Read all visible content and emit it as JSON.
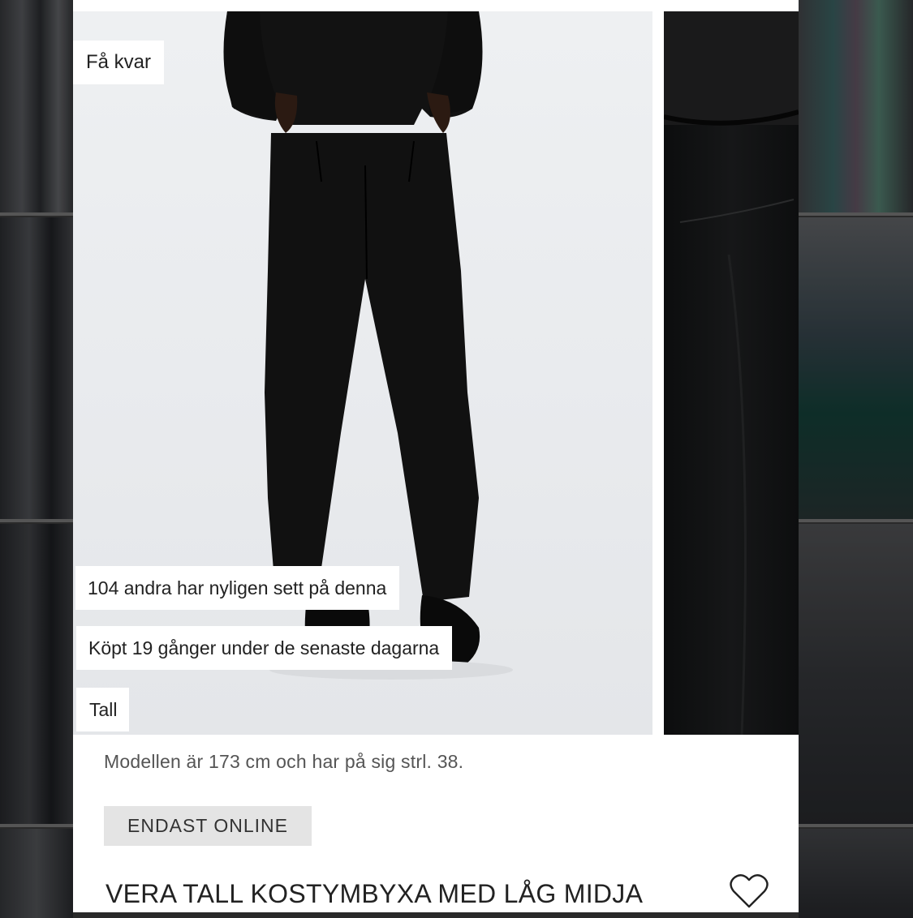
{
  "badges": {
    "few_left": "Få kvar",
    "recently_viewed": "104 andra har nyligen sett på denna",
    "recently_bought": "Köpt 19 gånger under de senaste dagarna",
    "fit": "Tall"
  },
  "product": {
    "model_info": "Modellen är 173 cm och har på sig strl. 38.",
    "online_tag": "ENDAST ONLINE",
    "title": "VERA TALL KOSTYMBYXA MED LÅG MIDJA"
  },
  "icons": {
    "favorite": "heart-outline-icon"
  },
  "colors": {
    "card_background": "#ffffff",
    "tag_background": "#e4e4e4",
    "text_primary": "#222222",
    "text_secondary": "#555555"
  }
}
